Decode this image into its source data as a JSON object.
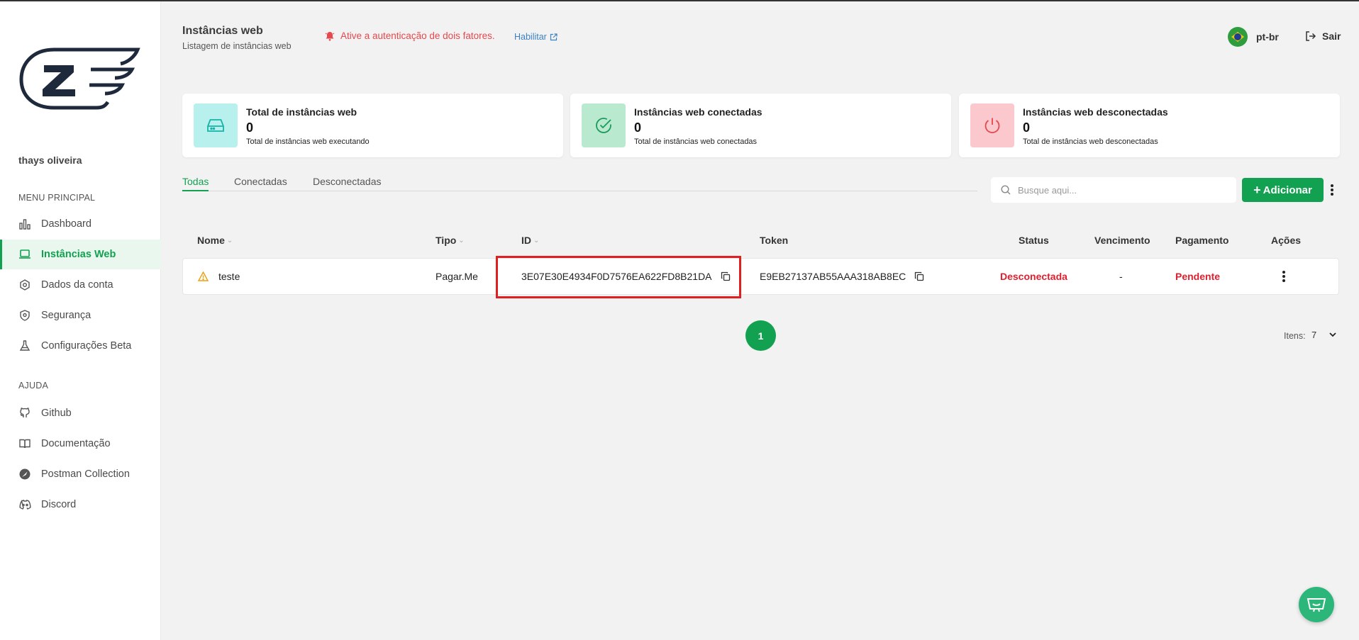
{
  "sidebar": {
    "user_name": "thays oliveira",
    "main_menu_label": "MENU PRINCIPAL",
    "help_label": "AJUDA",
    "items": [
      {
        "label": "Dashboard",
        "icon": "bar-chart-icon"
      },
      {
        "label": "Instâncias Web",
        "icon": "laptop-icon",
        "active": true
      },
      {
        "label": "Dados da conta",
        "icon": "settings-icon"
      },
      {
        "label": "Segurança",
        "icon": "shield-icon"
      },
      {
        "label": "Configurações Beta",
        "icon": "flask-icon"
      }
    ],
    "help_items": [
      {
        "label": "Github",
        "icon": "github-icon"
      },
      {
        "label": "Documentação",
        "icon": "book-icon"
      },
      {
        "label": "Postman Collection",
        "icon": "postman-icon"
      },
      {
        "label": "Discord",
        "icon": "discord-icon"
      }
    ]
  },
  "header": {
    "title": "Instâncias web",
    "subtitle": "Listagem de instâncias web",
    "alert_text": "Ative a autenticação de dois fatores.",
    "enable_link": "Habilitar",
    "language": "pt-br",
    "logout": "Sair"
  },
  "cards": [
    {
      "title": "Total de instâncias web",
      "value": "0",
      "desc": "Total de instâncias web executando",
      "icon": "hard-drive-icon",
      "bg": "#b7f0ec",
      "fg": "#17b3a6"
    },
    {
      "title": "Instâncias web conectadas",
      "value": "0",
      "desc": "Total de instâncias web conectadas",
      "icon": "check-circle-icon",
      "bg": "#b9ead0",
      "fg": "#1a9b5b"
    },
    {
      "title": "Instâncias web desconectadas",
      "value": "0",
      "desc": "Total de instâncias web desconectadas",
      "icon": "power-icon",
      "bg": "#fbc9cd",
      "fg": "#e5484d"
    }
  ],
  "tabs": [
    {
      "label": "Todas",
      "active": true
    },
    {
      "label": "Conectadas"
    },
    {
      "label": "Desconectadas"
    }
  ],
  "search": {
    "placeholder": "Busque aqui..."
  },
  "add_button": {
    "label": "Adicionar"
  },
  "table": {
    "columns": [
      "Nome",
      "Tipo",
      "ID",
      "Token",
      "Status",
      "Vencimento",
      "Pagamento",
      "Ações"
    ],
    "rows": [
      {
        "name": "teste",
        "type": "Pagar.Me",
        "id": "3E07E30E4934F0D7576EA622FD8B21DA",
        "token": "E9EB27137AB55AAA318AB8EC",
        "status": "Desconectada",
        "due": "-",
        "payment": "Pendente"
      }
    ]
  },
  "pagination": {
    "current_page": "1",
    "items_label": "Itens:",
    "items_per_page": "7"
  },
  "colors": {
    "accent": "#12a150",
    "danger": "#e0202f",
    "link": "#3b82c4"
  }
}
